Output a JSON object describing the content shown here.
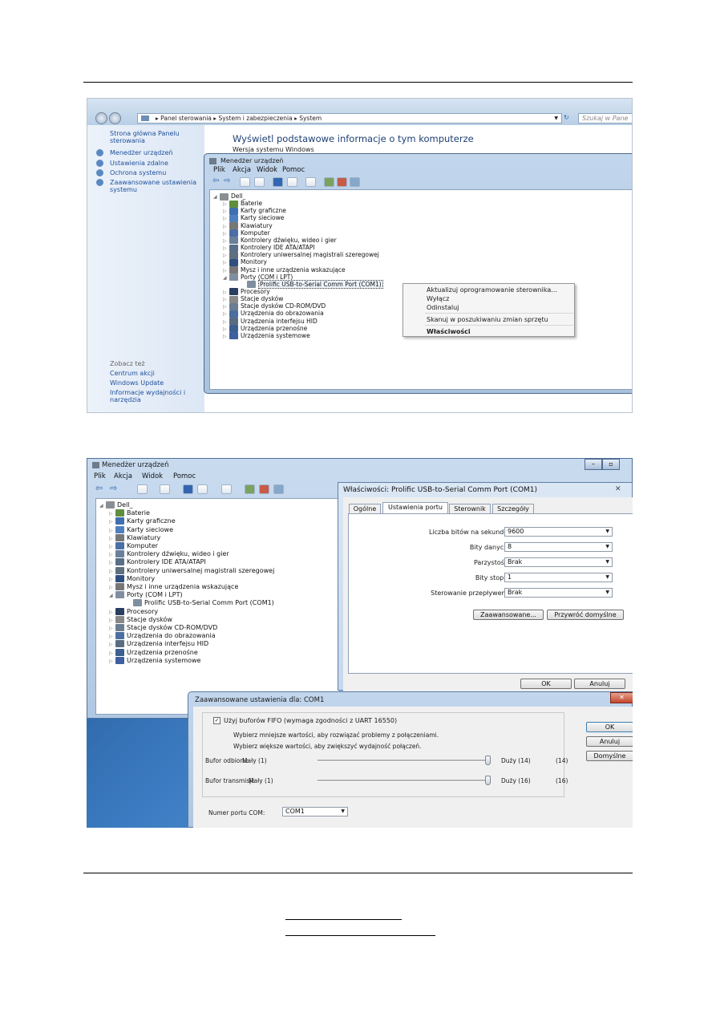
{
  "shot1": {
    "explorer": {
      "breadcrumb": [
        "Panel sterowania",
        "System i zabezpieczenia",
        "System"
      ],
      "search_placeholder": "Szukaj w Pane",
      "left": {
        "home": "Strona główna Panelu sterowania",
        "items": [
          "Menedżer urządzeń",
          "Ustawienia zdalne",
          "Ochrona systemu",
          "Zaawansowane ustawienia systemu"
        ],
        "see_also": "Zobacz też",
        "see_items": [
          "Centrum akcji",
          "Windows Update",
          "Informacje wydajności i narzędzia"
        ]
      },
      "heading": "Wyświetl podstawowe informacje o tym komputerze",
      "subheading": "Wersja systemu Windows"
    },
    "devmgr": {
      "title": "Menedżer urządzeń",
      "menu": [
        "Plik",
        "Akcja",
        "Widok",
        "Pomoc"
      ],
      "tree": [
        "Dell_",
        "Baterie",
        "Karty graficzne",
        "Karty sieciowe",
        "Klawiatury",
        "Komputer",
        "Kontrolery dźwięku, wideo i gier",
        "Kontrolery IDE ATA/ATAPI",
        "Kontrolery uniwersalnej magistrali szeregowej",
        "Monitory",
        "Mysz i inne urządzenia wskazujące",
        "Porty (COM i LPT)",
        "Prolific USB-to-Serial Comm Port (COM1)",
        "Procesory",
        "Stacje dysków",
        "Stacje dysków CD-ROM/DVD",
        "Urządzenia do obrazowania",
        "Urządzenia interfejsu HID",
        "Urządzenia przenośne",
        "Urządzenia systemowe"
      ],
      "context_menu": [
        "Aktualizuj oprogramowanie sterownika...",
        "Wyłącz",
        "Odinstaluj",
        "Skanuj w poszukiwaniu zmian sprzętu",
        "Właściwości"
      ]
    }
  },
  "shot2": {
    "devmgr": {
      "title": "Menedżer urządzeń",
      "menu": [
        "Plik",
        "Akcja",
        "Widok",
        "Pomoc"
      ],
      "tree": [
        "Dell_",
        "Baterie",
        "Karty graficzne",
        "Karty sieciowe",
        "Klawiatury",
        "Komputer",
        "Kontrolery dźwięku, wideo i gier",
        "Kontrolery IDE ATA/ATAPI",
        "Kontrolery uniwersalnej magistrali szeregowej",
        "Monitory",
        "Mysz i inne urządzenia wskazujące",
        "Porty (COM i LPT)",
        "Prolific USB-to-Serial Comm Port (COM1)",
        "Procesory",
        "Stacje dysków",
        "Stacje dysków CD-ROM/DVD",
        "Urządzenia do obrazowania",
        "Urządzenia interfejsu HID",
        "Urządzenia przenośne",
        "Urządzenia systemowe"
      ]
    },
    "props": {
      "title": "Właściwości: Prolific USB-to-Serial Comm Port (COM1)",
      "tabs": [
        "Ogólne",
        "Ustawienia portu",
        "Sterownik",
        "Szczegóły"
      ],
      "fields": [
        {
          "label": "Liczba bitów na sekundę:",
          "value": "9600"
        },
        {
          "label": "Bity danych:",
          "value": "8"
        },
        {
          "label": "Parzystość:",
          "value": "Brak"
        },
        {
          "label": "Bity stopu:",
          "value": "1"
        },
        {
          "label": "Sterowanie przepływem:",
          "value": "Brak"
        }
      ],
      "advanced_button": "Zaawansowane...",
      "restore_button": "Przywróć domyślne",
      "ok": "OK",
      "cancel": "Anuluj"
    },
    "advanced": {
      "title": "Zaawansowane ustawienia dla: COM1",
      "fifo_label": "Użyj buforów FIFO (wymaga zgodności z UART 16550)",
      "hint1": "Wybierz mniejsze wartości, aby rozwiązać problemy z połączeniami.",
      "hint2": "Wybierz większe wartości, aby zwiększyć wydajność połączeń.",
      "rx": {
        "label": "Bufor odbioru:",
        "min": "Mały (1)",
        "max": "Duży (14)",
        "value": "(14)",
        "level": 1.0
      },
      "tx": {
        "label": "Bufor transmisji:",
        "min": "Mały (1)",
        "max": "Duży (16)",
        "value": "(16)",
        "level": 1.0
      },
      "com_label": "Numer portu COM:",
      "com_value": "COM1",
      "ok": "OK",
      "cancel": "Anuluj",
      "defaults": "Domyślne"
    }
  }
}
